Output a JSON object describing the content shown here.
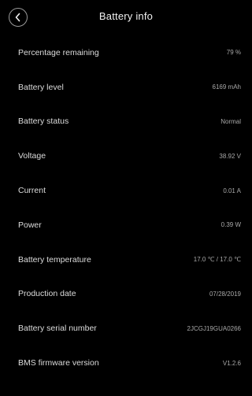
{
  "header": {
    "title": "Battery info",
    "back_icon": "chevron-left-icon"
  },
  "colors": {
    "background": "#000000",
    "label": "#dcdcdc",
    "value": "#a8a8a8"
  },
  "rows": [
    {
      "label": "Percentage remaining",
      "value": "79 %"
    },
    {
      "label": "Battery level",
      "value": "6169 mAh"
    },
    {
      "label": "Battery status",
      "value": "Normal"
    },
    {
      "label": "Voltage",
      "value": "38.92 V"
    },
    {
      "label": "Current",
      "value": "0.01 A"
    },
    {
      "label": "Power",
      "value": "0.39 W"
    },
    {
      "label": "Battery temperature",
      "value": "17.0 ℃ / 17.0 ℃"
    },
    {
      "label": "Production date",
      "value": "07/28/2019"
    },
    {
      "label": "Battery serial number",
      "value": "2JCGJ19GUA0266"
    },
    {
      "label": "BMS firmware version",
      "value": "V1.2.6"
    }
  ]
}
